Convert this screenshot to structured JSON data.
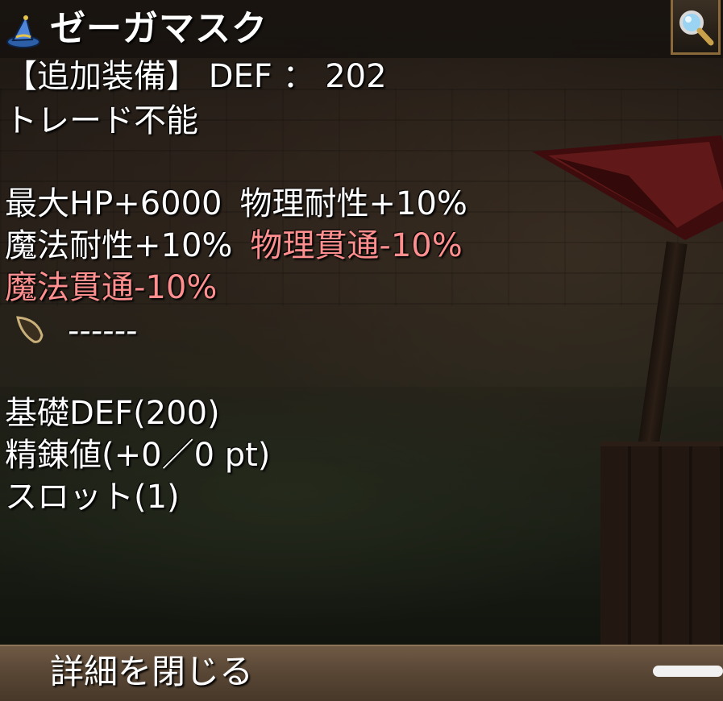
{
  "item": {
    "name": "ゼーガマスク",
    "icon": "wizard-hat-icon"
  },
  "search_icon": "magnifier-icon",
  "lines": {
    "equip": "【追加装備】 DEF ： 202",
    "trade": "トレード不能",
    "stat_line1_a": "最大HP+6000",
    "stat_line1_b": "物理耐性+10%",
    "stat_line2_a": "魔法耐性+10%",
    "stat_line2_b": "物理貫通-10%",
    "stat_line3": "魔法貫通-10%",
    "card_slot": "------",
    "base_def": "基礎DEF(200)",
    "refine": "精錬値(+0／0 pt)",
    "slot": "スロット(1)"
  },
  "footer": {
    "close_label": "詳細を閉じる"
  },
  "colors": {
    "text": "#ffffff",
    "negative": "#ff8f8f",
    "frame": "#8a6a3b"
  }
}
